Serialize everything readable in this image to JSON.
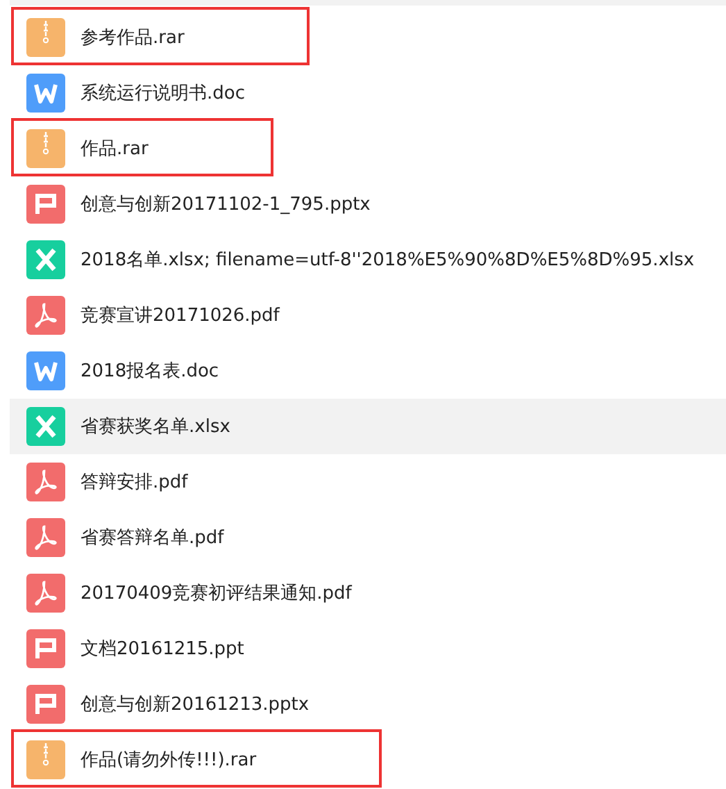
{
  "files": [
    {
      "name": "参考作品.rar",
      "kind": "zip",
      "selected": false,
      "highlighted": true
    },
    {
      "name": "系统运行说明书.doc",
      "kind": "word",
      "selected": false,
      "highlighted": false
    },
    {
      "name": "作品.rar",
      "kind": "zip",
      "selected": false,
      "highlighted": true
    },
    {
      "name": "创意与创新20171102-1_795.pptx",
      "kind": "ppt",
      "selected": false,
      "highlighted": false
    },
    {
      "name": "2018名单.xlsx; filename=utf-8''2018%E5%90%8D%E5%8D%95.xlsx",
      "kind": "excel",
      "selected": false,
      "highlighted": false
    },
    {
      "name": "竞赛宣讲20171026.pdf",
      "kind": "pdf",
      "selected": false,
      "highlighted": false
    },
    {
      "name": "2018报名表.doc",
      "kind": "word",
      "selected": false,
      "highlighted": false
    },
    {
      "name": "省赛获奖名单.xlsx",
      "kind": "excel",
      "selected": true,
      "highlighted": false
    },
    {
      "name": "答辩安排.pdf",
      "kind": "pdf",
      "selected": false,
      "highlighted": false
    },
    {
      "name": "省赛答辩名单.pdf",
      "kind": "pdf",
      "selected": false,
      "highlighted": false
    },
    {
      "name": "20170409竞赛初评结果通知.pdf",
      "kind": "pdf",
      "selected": false,
      "highlighted": false
    },
    {
      "name": "文档20161215.ppt",
      "kind": "ppt",
      "selected": false,
      "highlighted": false
    },
    {
      "name": "创意与创新20161213.pptx",
      "kind": "ppt",
      "selected": false,
      "highlighted": false
    },
    {
      "name": "作品(请勿外传!!!).rar",
      "kind": "zip",
      "selected": false,
      "highlighted": true
    }
  ]
}
